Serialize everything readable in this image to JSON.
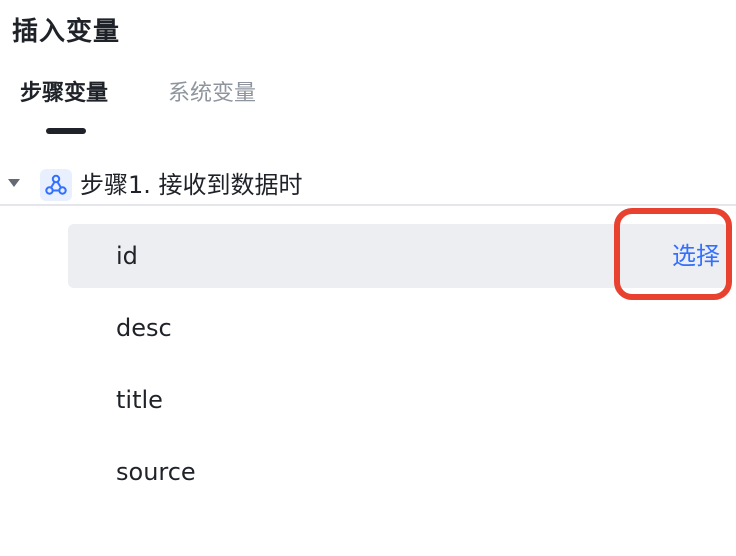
{
  "panel": {
    "title": "插入变量"
  },
  "tabs": [
    {
      "label": "步骤变量",
      "active": true
    },
    {
      "label": "系统变量",
      "active": false
    }
  ],
  "tree": {
    "node_label": "步骤1. 接收到数据时",
    "node_icon": "webhook-icon",
    "expanded": true,
    "variables": [
      {
        "name": "id",
        "hovered": true,
        "action": "选择"
      },
      {
        "name": "desc"
      },
      {
        "name": "title"
      },
      {
        "name": "source"
      }
    ]
  },
  "colors": {
    "accent": "#3370ff",
    "highlight": "#e8412f",
    "hover_bg": "#eceef1"
  }
}
